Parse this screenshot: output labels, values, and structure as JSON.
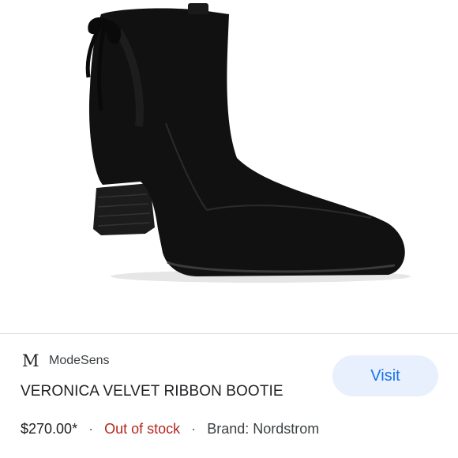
{
  "source": {
    "logo": "M",
    "name": "ModeSens"
  },
  "product": {
    "title": "VERONICA VELVET RIBBON BOOTIE",
    "price": "$270.00*",
    "separator": "·",
    "availability": "Out of stock",
    "brand": "Brand: Nordstrom",
    "image_icon": "ankle-boot-image"
  },
  "actions": {
    "visit_label": "Visit"
  },
  "colors": {
    "accent": "#1a73e8",
    "button_bg": "#e8f0fe",
    "out_of_stock": "#b3261e"
  }
}
